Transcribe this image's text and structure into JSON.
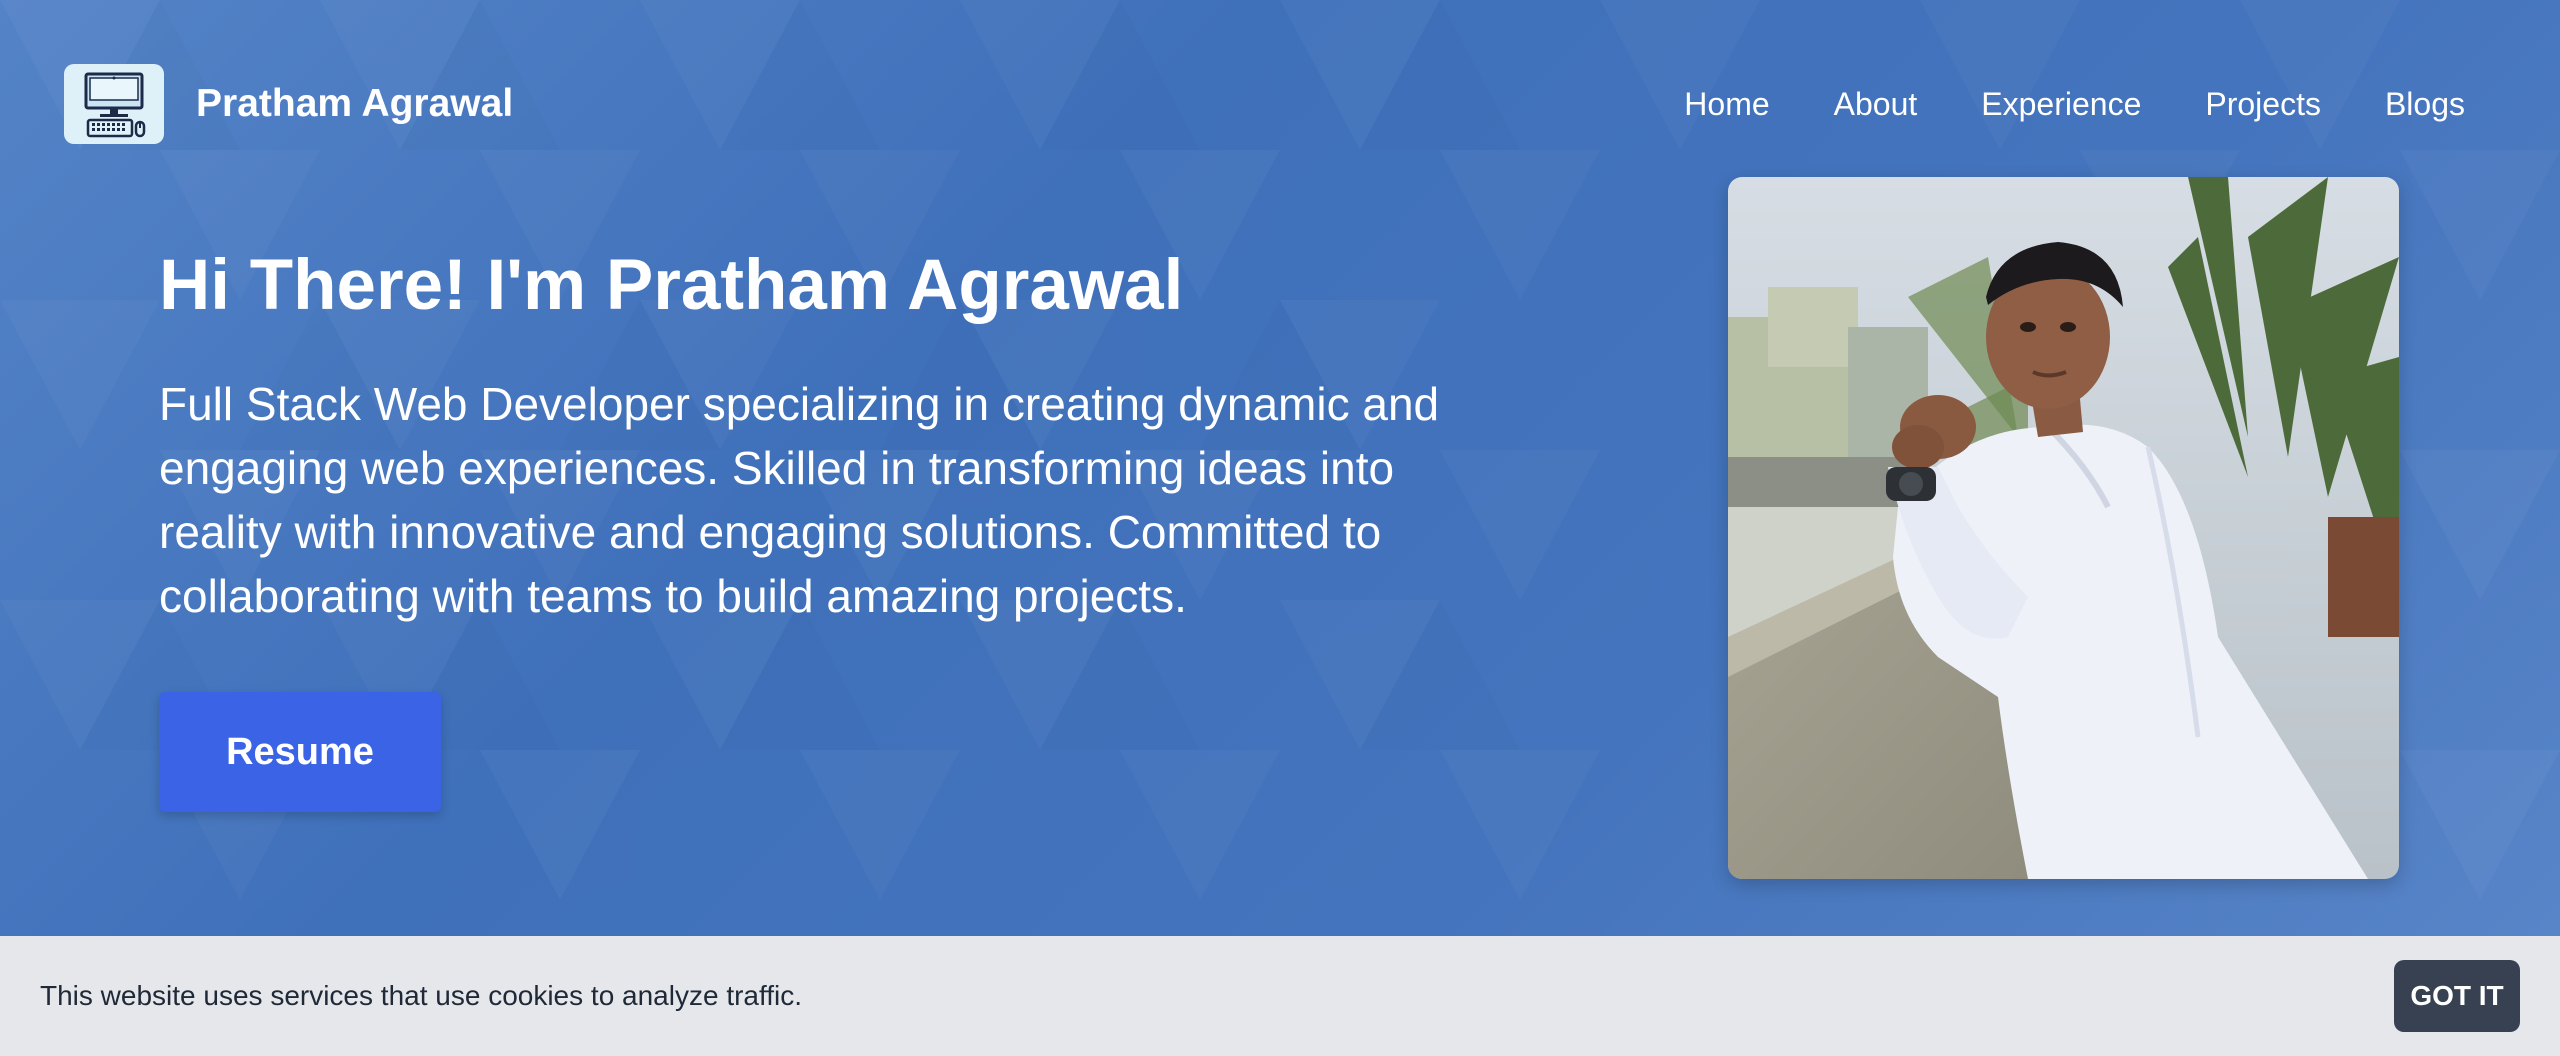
{
  "header": {
    "logo_icon": "computer-icon",
    "brand": "Pratham Agrawal",
    "nav": [
      {
        "label": "Home"
      },
      {
        "label": "About"
      },
      {
        "label": "Experience"
      },
      {
        "label": "Projects"
      },
      {
        "label": "Blogs"
      }
    ]
  },
  "hero": {
    "title": "Hi There! I'm Pratham Agrawal",
    "description": "Full Stack Web Developer specializing in creating dynamic and engaging web experiences. Skilled in transforming ideas into reality with innovative and engaging solutions. Committed to collaborating with teams to build amazing projects.",
    "resume_label": "Resume"
  },
  "cookie": {
    "text": "This website uses services that use cookies to analyze traffic.",
    "button": "GOT IT"
  },
  "colors": {
    "background": "#4474bd",
    "resume_button": "#3b63e6",
    "cookie_banner": "#e5e7eb",
    "cookie_button": "#374151",
    "logo_bg": "#dff1f8"
  }
}
